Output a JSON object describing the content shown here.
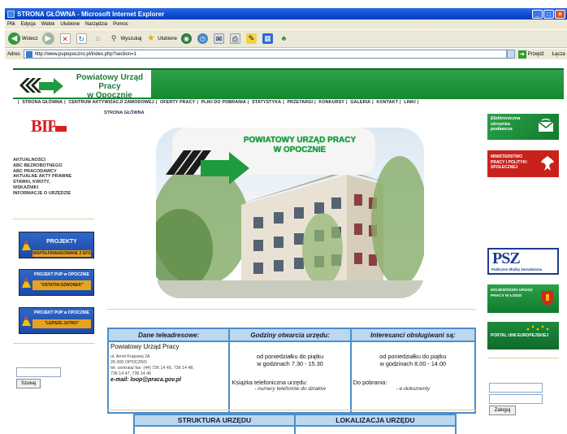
{
  "window": {
    "title": "STRONA GŁÓWNA - Microsoft Internet Explorer",
    "controls": [
      "_",
      "□",
      "×"
    ]
  },
  "menu": [
    "Plik",
    "Edycja",
    "Widok",
    "Ulubione",
    "Narzędzia",
    "Pomoc"
  ],
  "toolbar": {
    "back": "Wstecz",
    "search": "Wyszukaj",
    "favorites": "Ulubione"
  },
  "addressbar": {
    "label": "Adres",
    "url": "http://www.pupopoczno.pl/index.php?section=1",
    "go": "Przejdź",
    "links": "Łącza"
  },
  "site": {
    "title_line1": "Powiatowy Urząd Pracy",
    "title_line2": "w Opocznie",
    "nav": [
      "STRONA GŁÓWNA",
      "CENTRUM AKTYWIZACJI ZAWODOWEJ",
      "OFERTY PRACY",
      "PLIKI DO POBRANIA",
      "STATYSTYKA",
      "PRZETARGI",
      "KONKURSY",
      "GALERIA",
      "KONTAKT",
      "LINKI"
    ],
    "breadcrumb": "STRONA GŁÓWNA"
  },
  "left": {
    "bip": "BIP",
    "links": [
      "AKTUALNOŚCI",
      "ABC BEZROBOTNEGO",
      "ABC PRACODAWCY",
      "AKTUALNE AKTY PRAWNE",
      "STAWKI, KWOTY, WSKAŹNIKI",
      "INFORMACJE O URZĘDZIE"
    ],
    "banner1": {
      "title": "PROJEKTY",
      "sub": "WSPÓŁFINANSOWANE Z EFS"
    },
    "banner2": {
      "title": "PROJEKT PUP w OPOCZNIE",
      "sub": "\"OSTATNI DZWONEK\""
    },
    "banner3": {
      "title": "PROJEKT PUP w OPOCZNIE",
      "sub": "\"LEPSZE JUTRO\""
    },
    "search_button": "Szukaj"
  },
  "hero": {
    "line1": "POWIATOWY URZĄD PRACY",
    "line2": "W OPOCZNIE"
  },
  "contact": {
    "headers": [
      "Dane teleadresowe:",
      "Godziny otwarcia urzędu:",
      "Interesanci obsługiwani są:"
    ],
    "name": "Powiatowy Urząd Pracy",
    "address": "ul. Armii Krajowej 2A",
    "city": "26-300 OPOCZNO",
    "phone": "tel. centrala/ fax: (44) 736 14 45, 736 14 48,",
    "phone2": "736 14 47, 736 14 46",
    "email": "e-mail: loop@praca.gov.pl",
    "hours1": "od poniedziałku do piątku",
    "hours2": "w godzinach 7.30 - 15.30",
    "phonebook": "Książka telefoniczna urzędu:",
    "phonebook_link": "- numery telefonów do działów",
    "served1": "od poniedziałku do piątku",
    "served2": "w godzinach 8.00 - 14.00",
    "downloads": "Do pobrania:",
    "downloads_link": "- e-dokumenty"
  },
  "structure": {
    "left": "STRUKTURA URZĘDU",
    "right": "LOKALIZACJA URZĘDU"
  },
  "right": {
    "e_skrzynka": "Elektroniczna skrzynka podawcza",
    "ministry": "MINISTERSTWO PRACY I POLITYKI SPOŁECZNEJ",
    "psz_big": "PSZ",
    "psz_small": "Publiczne Służby Zatrudnienia",
    "wup": "WOJEWÓDZKI URZĄD PRACY W ŁODZI",
    "eu": "PORTAL UNII EUROPEJSKIEJ",
    "login_button": "Zaloguj"
  },
  "colors": {
    "green": "#1e9a3f",
    "table_border": "#4a8fcc",
    "table_head": "#bcd8ee",
    "bip_red": "#d61f1f",
    "titlebar": "#0b4ad0"
  }
}
